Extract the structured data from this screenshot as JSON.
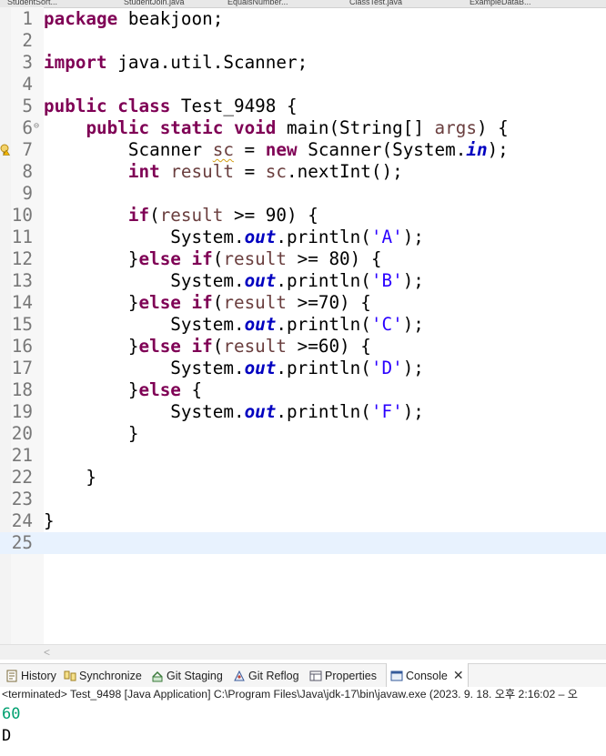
{
  "editor": {
    "open_tabs": [
      "StudentSort...",
      "StudentJoin.java",
      "EqualsNumber...",
      "ClassTest.java",
      "ExampleDataB..."
    ],
    "lines": [
      {
        "n": "1",
        "t": [
          {
            "c": "kw",
            "v": "package"
          },
          {
            "v": " beakjoon;"
          }
        ]
      },
      {
        "n": "2",
        "t": []
      },
      {
        "n": "3",
        "t": [
          {
            "c": "kw",
            "v": "import"
          },
          {
            "v": " java.util.Scanner;"
          }
        ]
      },
      {
        "n": "4",
        "t": []
      },
      {
        "n": "5",
        "t": [
          {
            "c": "kw",
            "v": "public"
          },
          {
            "v": " "
          },
          {
            "c": "kw",
            "v": "class"
          },
          {
            "v": " Test_9498 {"
          }
        ]
      },
      {
        "n": "6",
        "fold": true,
        "t": [
          {
            "v": "    "
          },
          {
            "c": "kw",
            "v": "public"
          },
          {
            "v": " "
          },
          {
            "c": "kw",
            "v": "static"
          },
          {
            "v": " "
          },
          {
            "c": "kw",
            "v": "void"
          },
          {
            "v": " main(String[] "
          },
          {
            "c": "var",
            "v": "args"
          },
          {
            "v": ") {"
          }
        ]
      },
      {
        "n": "7",
        "warn": true,
        "t": [
          {
            "v": "        Scanner "
          },
          {
            "c": "var squig",
            "v": "sc"
          },
          {
            "v": " = "
          },
          {
            "c": "kw",
            "v": "new"
          },
          {
            "v": " Scanner(System."
          },
          {
            "c": "fld",
            "v": "in"
          },
          {
            "v": ");"
          }
        ]
      },
      {
        "n": "8",
        "t": [
          {
            "v": "        "
          },
          {
            "c": "kw",
            "v": "int"
          },
          {
            "v": " "
          },
          {
            "c": "var",
            "v": "result"
          },
          {
            "v": " = "
          },
          {
            "c": "var",
            "v": "sc"
          },
          {
            "v": ".nextInt();"
          }
        ]
      },
      {
        "n": "9",
        "t": []
      },
      {
        "n": "10",
        "t": [
          {
            "v": "        "
          },
          {
            "c": "kw",
            "v": "if"
          },
          {
            "v": "("
          },
          {
            "c": "var",
            "v": "result"
          },
          {
            "v": " >= 90) {"
          }
        ]
      },
      {
        "n": "11",
        "t": [
          {
            "v": "            System."
          },
          {
            "c": "fld",
            "v": "out"
          },
          {
            "v": ".println("
          },
          {
            "c": "str",
            "v": "'A'"
          },
          {
            "v": ");"
          }
        ]
      },
      {
        "n": "12",
        "t": [
          {
            "v": "        }"
          },
          {
            "c": "kw",
            "v": "else"
          },
          {
            "v": " "
          },
          {
            "c": "kw",
            "v": "if"
          },
          {
            "v": "("
          },
          {
            "c": "var",
            "v": "result"
          },
          {
            "v": " >= 80) {"
          }
        ]
      },
      {
        "n": "13",
        "t": [
          {
            "v": "            System."
          },
          {
            "c": "fld",
            "v": "out"
          },
          {
            "v": ".println("
          },
          {
            "c": "str",
            "v": "'B'"
          },
          {
            "v": ");"
          }
        ]
      },
      {
        "n": "14",
        "t": [
          {
            "v": "        }"
          },
          {
            "c": "kw",
            "v": "else"
          },
          {
            "v": " "
          },
          {
            "c": "kw",
            "v": "if"
          },
          {
            "v": "("
          },
          {
            "c": "var",
            "v": "result"
          },
          {
            "v": " >=70) {"
          }
        ]
      },
      {
        "n": "15",
        "t": [
          {
            "v": "            System."
          },
          {
            "c": "fld",
            "v": "out"
          },
          {
            "v": ".println("
          },
          {
            "c": "str",
            "v": "'C'"
          },
          {
            "v": ");"
          }
        ]
      },
      {
        "n": "16",
        "t": [
          {
            "v": "        }"
          },
          {
            "c": "kw",
            "v": "else"
          },
          {
            "v": " "
          },
          {
            "c": "kw",
            "v": "if"
          },
          {
            "v": "("
          },
          {
            "c": "var",
            "v": "result"
          },
          {
            "v": " >=60) {"
          }
        ]
      },
      {
        "n": "17",
        "t": [
          {
            "v": "            System."
          },
          {
            "c": "fld",
            "v": "out"
          },
          {
            "v": ".println("
          },
          {
            "c": "str",
            "v": "'D'"
          },
          {
            "v": ");"
          }
        ]
      },
      {
        "n": "18",
        "t": [
          {
            "v": "        }"
          },
          {
            "c": "kw",
            "v": "else"
          },
          {
            "v": " {"
          }
        ]
      },
      {
        "n": "19",
        "t": [
          {
            "v": "            System."
          },
          {
            "c": "fld",
            "v": "out"
          },
          {
            "v": ".println("
          },
          {
            "c": "str",
            "v": "'F'"
          },
          {
            "v": ");"
          }
        ]
      },
      {
        "n": "20",
        "t": [
          {
            "v": "        }"
          }
        ]
      },
      {
        "n": "21",
        "t": []
      },
      {
        "n": "22",
        "t": [
          {
            "v": "    }"
          }
        ]
      },
      {
        "n": "23",
        "t": []
      },
      {
        "n": "24",
        "t": [
          {
            "v": "}"
          }
        ]
      },
      {
        "n": "25",
        "current": true,
        "t": []
      }
    ]
  },
  "views": {
    "tabs": [
      {
        "label": "History",
        "icon": "history-icon"
      },
      {
        "label": "Synchronize",
        "icon": "synchronize-icon"
      },
      {
        "label": "Git Staging",
        "icon": "git-staging-icon"
      },
      {
        "label": "Git Reflog",
        "icon": "git-reflog-icon"
      },
      {
        "label": "Properties",
        "icon": "properties-icon"
      },
      {
        "label": "Console",
        "icon": "console-icon",
        "active": true
      }
    ]
  },
  "console": {
    "status": "<terminated> Test_9498 [Java Application] C:\\Program Files\\Java\\jdk-17\\bin\\javaw.exe  (2023. 9. 18. 오후 2:16:02 – 오",
    "input_echo": "60",
    "output": "D"
  }
}
